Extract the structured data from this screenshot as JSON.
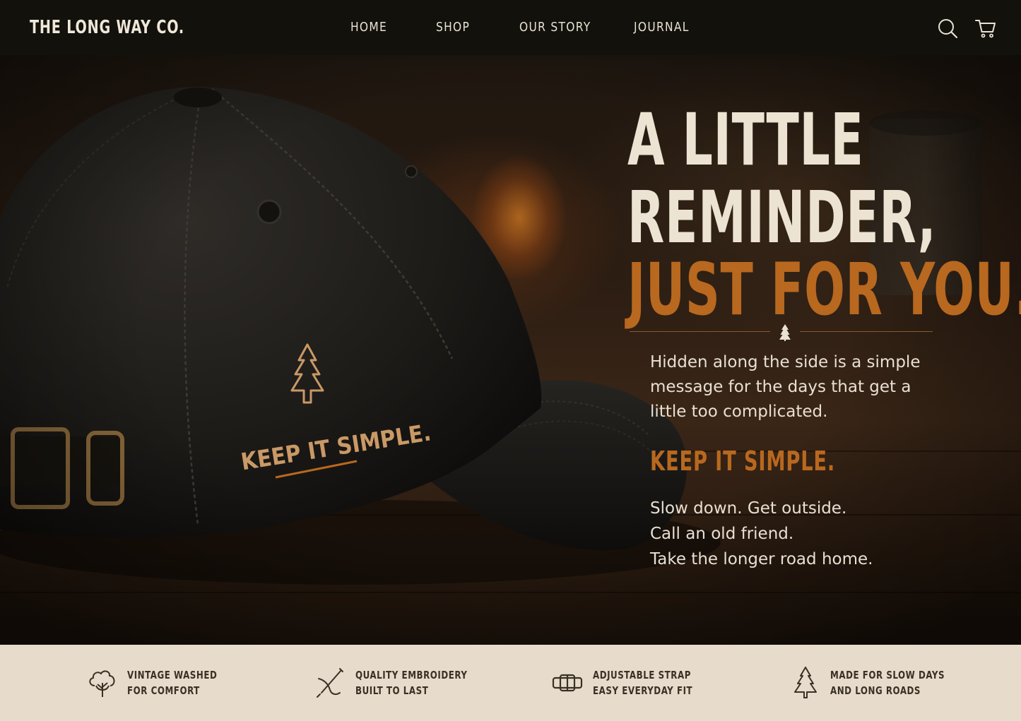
{
  "header": {
    "brand": "THE LONG WAY CO.",
    "nav": [
      {
        "label": "HOME"
      },
      {
        "label": "SHOP"
      },
      {
        "label": "OUR STORY"
      },
      {
        "label": "JOURNAL"
      }
    ],
    "icons": [
      "search-icon",
      "cart-icon"
    ]
  },
  "hero": {
    "headline_line1": "A LITTLE",
    "headline_line2": "REMINDER,",
    "headline_line3": "JUST FOR YOU.",
    "paragraph": "Hidden along the side is a simple message for the days that get a little too complicated.",
    "subhead": "KEEP IT SIMPLE.",
    "lines": [
      "Slow down. Get outside.",
      "Call an old friend.",
      "Take the longer road home."
    ],
    "cap_embroidery": "KEEP IT SIMPLE."
  },
  "features": [
    {
      "icon": "cotton-icon",
      "line1": "VINTAGE WASHED",
      "line2": "FOR COMFORT"
    },
    {
      "icon": "needle-icon",
      "line1": "QUALITY EMBROIDERY",
      "line2": "BUILT TO LAST"
    },
    {
      "icon": "strap-icon",
      "line1": "ADJUSTABLE STRAP",
      "line2": "EASY EVERYDAY FIT"
    },
    {
      "icon": "pine-tree-icon",
      "line1": "MADE FOR SLOW DAYS",
      "line2": "AND LONG ROADS"
    }
  ],
  "colors": {
    "header_bg": "#12110c",
    "accent": "#b8681f",
    "cream": "#ece3d2",
    "feature_bg": "#e7dccb"
  }
}
